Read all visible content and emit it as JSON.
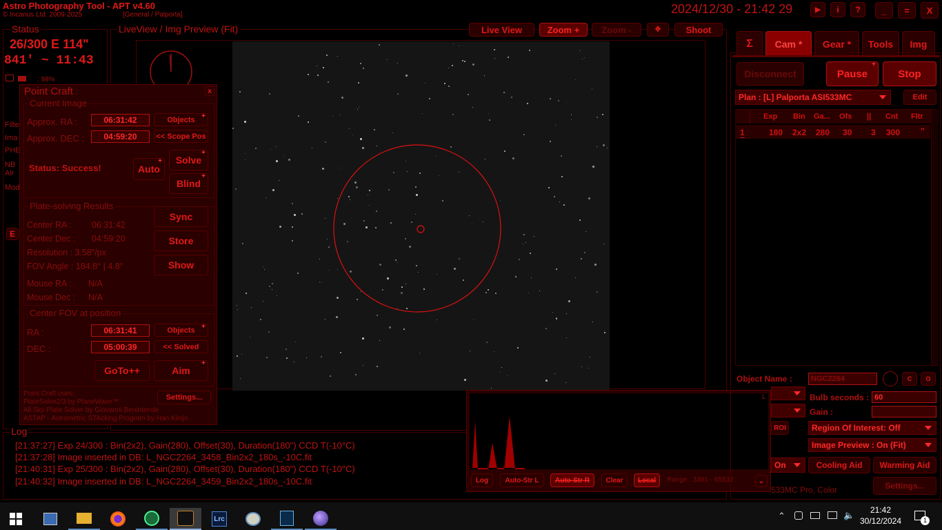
{
  "app": {
    "title": "Astro Photography Tool  -  APT v4.60",
    "copyright": "© Incanus Ltd. 2009-2025",
    "profile": "[General / Palporta]",
    "datetime": "2024/12/30 - 21:42 29"
  },
  "window_icons": {
    "play": "▶",
    "info": "i",
    "help": "?",
    "minimize": "_",
    "maximize": "=",
    "close": "X"
  },
  "status": {
    "title": "Status",
    "line1": "26/300 E 114\"",
    "line2": "841' ~ 11:43",
    "battery": ": 98%",
    "side_labels": [
      "Filte",
      "Ima",
      "PHE",
      "NB",
      "Air",
      "Mod"
    ],
    "e_btn": "E"
  },
  "preview": {
    "title": "LiveView / Img Preview (Fit)",
    "live_view": "Live View",
    "zoom_plus": "Zoom +",
    "zoom_minus": "Zoom -",
    "crosshair": "⌖",
    "shoot": "Shoot"
  },
  "pointcraft": {
    "title": "Point Craft",
    "close": "x",
    "current_image": "Current Image",
    "ra_label": "Approx. RA :",
    "ra_value": "06:31:42",
    "objects1": "Objects",
    "dec_label": "Approx. DEC :",
    "dec_value": "04:59:20",
    "scope_pos": "<< Scope Pos",
    "status": "Status: Success!",
    "auto": "Auto",
    "solve": "Solve",
    "blind": "Blind",
    "results_title": "Plate-solving Results",
    "center_ra": "Center RA :",
    "center_ra_val": "06:31:42",
    "center_dec": "Center Dec :",
    "center_dec_val": "04:59:20",
    "resolution": "Resolution : 3.58\"/px",
    "fov": "FOV Angle : 184.8° | 4.8°",
    "mouse_ra": "Mouse RA :",
    "mouse_ra_val": "N/A",
    "mouse_dec": "Mouse Dec :",
    "mouse_dec_val": "N/A",
    "sync": "Sync",
    "store": "Store",
    "show": "Show",
    "center_title": "Center FOV at position",
    "ra2_label": "RA :",
    "ra2_value": "06:31:41",
    "objects2": "Objects",
    "dec2_label": "DEC :",
    "dec2_value": "05:00:39",
    "solved": "<< Solved",
    "goto": "GoTo++",
    "aim": "Aim",
    "uses": "Point Craft uses:",
    "credit1": "PlateSolve2/3 by PlaneWave™",
    "credit2": "All Sky Plate Solver by Giovanni Benintende",
    "credit3": "ASTAP - Astrometric STAcking Program by Han Kleijn",
    "settings": "Settings..."
  },
  "log": {
    "title": "Log",
    "lines": [
      "[21:37:27] Exp 24/300 : Bin(2x2), Gain(280), Offset(30), Duration(180\") CCD T(-10°C)",
      "[21:37:28] Image inserted in DB: L_NGC2264_3458_Bin2x2_180s_-10C.fit",
      "[21:40:31] Exp 25/300 : Bin(2x2), Gain(280), Offset(30), Duration(180\") CCD T(-10°C)",
      "[21:40:32] Image inserted in DB: L_NGC2264_3459_Bin2x2_180s_-10C.fit"
    ]
  },
  "histogram": {
    "l_label": "L",
    "log": "Log",
    "auto_str_l": "Auto-Str L",
    "auto_str_r": "Auto-Str R",
    "clear": "Clear",
    "local": "Local",
    "range": "Range : 3391 - 65532"
  },
  "right": {
    "tabs": [
      "Σ",
      "Cam *",
      "Gear *",
      "Tools",
      "Img"
    ],
    "disconnect": "Disconnect",
    "pause": "Pause",
    "stop": "Stop",
    "plan": "Plan : [L] Palporta ASI533MC",
    "edit": "Edit",
    "headers": [
      "Exp",
      "Bin",
      "Ga...",
      "Ofs",
      "||",
      "Cnt",
      "Fltr"
    ],
    "row": {
      "id": "1",
      "exp": "180",
      "bin": "2x2",
      "gain": "280",
      "ofs": "30",
      "pause": "3",
      "cnt": "300",
      "fltr": "\""
    },
    "object_label": "Object Name :",
    "object_value": "NGC2264",
    "bulb_label": "Bulb seconds :",
    "bulb_value": "60",
    "gain_label": "Gain :",
    "roi": "ROI",
    "roi_drop": "Region Of Interest: Off",
    "preview_drop": "Image Preview : On (Fit)",
    "on_drop": "On",
    "cooling": "Cooling Aid",
    "warming": "Warming Aid",
    "camera": "533MC Pro, Color",
    "settings": "Settings...",
    "c_btn": "C",
    "o_btn": "O"
  },
  "taskbar": {
    "time": "21:42",
    "date": "30/12/2024",
    "notifications": "1",
    "icons": [
      "windows-start-icon",
      "network-settings-icon",
      "file-explorer-icon",
      "firefox-icon",
      "phd2-icon",
      "apt-icon",
      "lightroom-icon",
      "paint-icon",
      "stellarium-icon",
      "astro-app-icon"
    ]
  }
}
